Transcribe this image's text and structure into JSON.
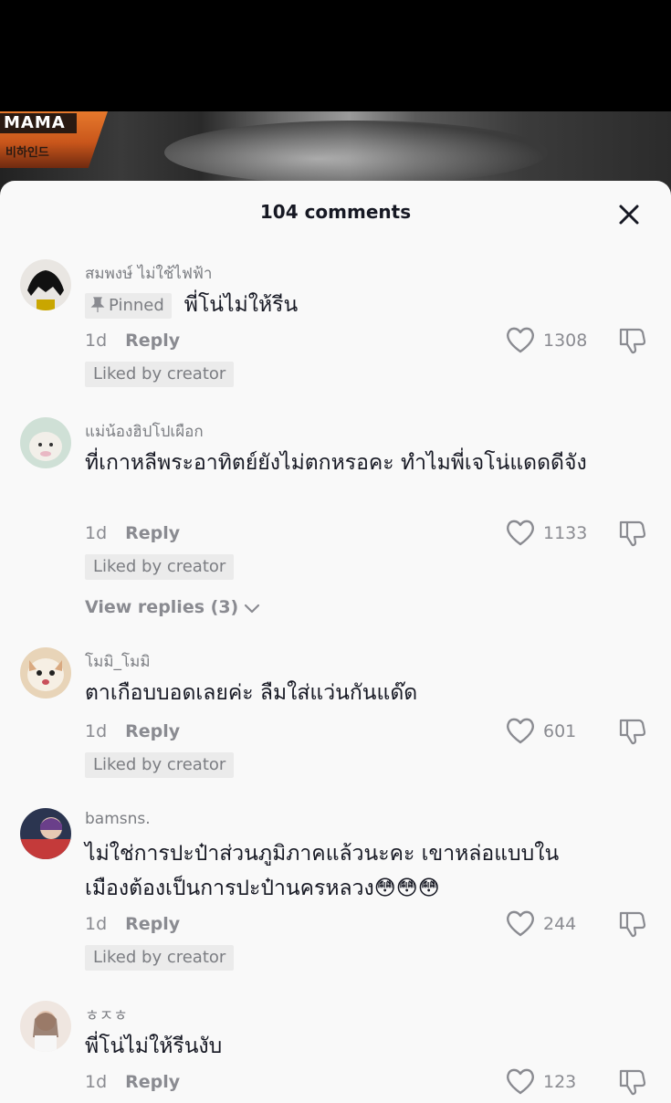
{
  "video": {
    "logo_text": "MAMA",
    "logo_sub": "비하인드"
  },
  "header": {
    "comment_count": "104 comments"
  },
  "comments": [
    {
      "username": "สมพงษ์ ไม่ใช้ไฟฟ้า",
      "pinned_label": "Pinned",
      "text": "พี่โน่ไม่ให้รีน",
      "time": "1d",
      "reply_label": "Reply",
      "likes": "1308",
      "liked_by": "Liked by creator"
    },
    {
      "username": "แม่น้องฮิปโปเผือก",
      "text": "ที่เกาหลีพระอาทิตย์ยังไม่ตกหรอคะ ทำไมพี่เจโน่แดดดีจัง",
      "time": "1d",
      "reply_label": "Reply",
      "likes": "1133",
      "liked_by": "Liked by creator",
      "view_replies": "View replies (3)"
    },
    {
      "username": "โมมิ_โมมิ",
      "text": "ตาเกือบบอดเลยค่ะ ลืมใส่แว่นกันแด๊ด",
      "time": "1d",
      "reply_label": "Reply",
      "likes": "601",
      "liked_by": "Liked by creator"
    },
    {
      "username": "bamsns.",
      "text": "ไม่ใช่การปะป๋าส่วนภูมิภาคแล้วนะคะ เขาหล่อแบบในเมืองต้องเป็นการปะป๋านครหลวง😳😳😳",
      "time": "1d",
      "reply_label": "Reply",
      "likes": "244",
      "liked_by": "Liked by creator"
    },
    {
      "username": "ㅎㅈㅎ",
      "text": "พี่โน่ไม่ให้รีนงับ",
      "time": "1d",
      "reply_label": "Reply",
      "likes": "123"
    }
  ],
  "colors": {
    "sheet_bg": "#f9f9f9",
    "secondary_text": "#8a8b91",
    "chip_bg": "#ebebeb"
  }
}
